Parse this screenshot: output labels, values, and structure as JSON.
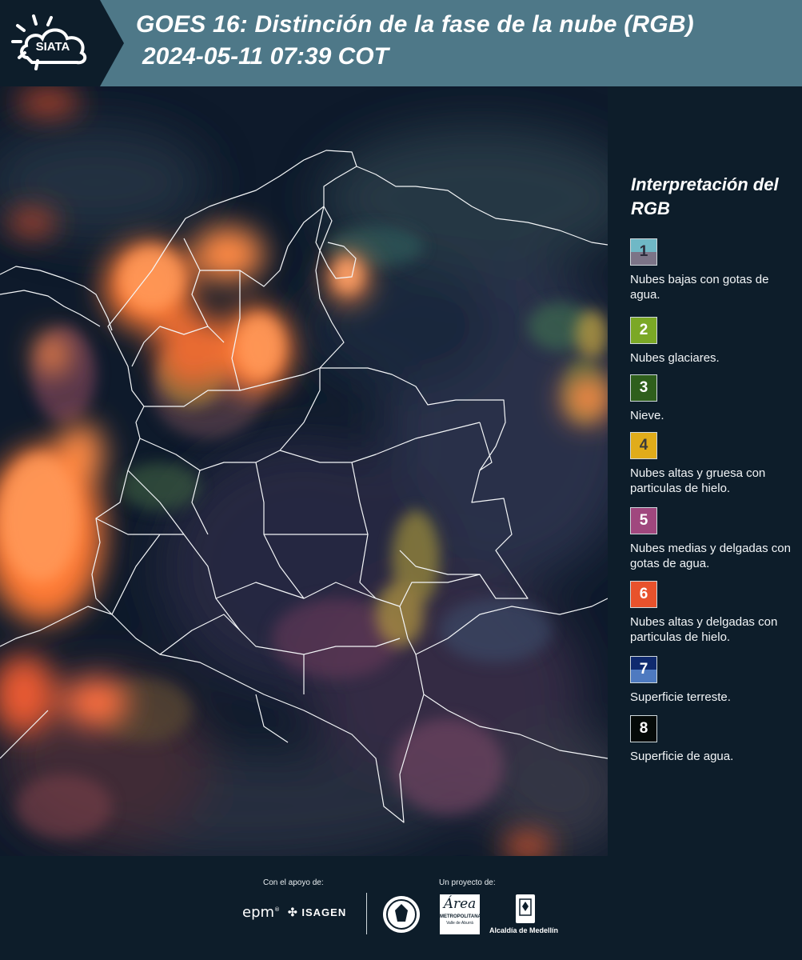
{
  "header": {
    "logo_text": "SIATA",
    "title_line1": "GOES 16: Distinción de la fase de la nube (RGB)",
    "title_line2": "2024-05-11 07:39 COT"
  },
  "legend": {
    "title": "Interpretación del RGB",
    "items": [
      {
        "number": "1",
        "label": "Nubes bajas con gotas de agua.",
        "color_top": "#6fb8c6",
        "color_bottom": "#7c7487"
      },
      {
        "number": "2",
        "label": "Nubes glaciares.",
        "color": "#7ba826"
      },
      {
        "number": "3",
        "label": "Nieve.",
        "color": "#2f5f1c"
      },
      {
        "number": "4",
        "label": "Nubes altas y gruesa con particulas de hielo.",
        "color": "#e0ac1a"
      },
      {
        "number": "5",
        "label": "Nubes medias y delgadas con gotas de agua.",
        "color": "#a0477e"
      },
      {
        "number": "6",
        "label": "Nubes altas y delgadas con particulas de hielo.",
        "color": "#e8522c"
      },
      {
        "number": "7",
        "label": "Superficie terreste.",
        "color_top": "#0f2a6e",
        "color_bottom": "#4e7ac0"
      },
      {
        "number": "8",
        "label": "Superficie de agua.",
        "color": "#050a08"
      }
    ]
  },
  "footer": {
    "support_label": "Con el apoyo de:",
    "project_label": "Un proyecto de:",
    "logos": {
      "epm": "epm",
      "isagen": "ISAGEN",
      "area_name": "Área",
      "area_sub": "METROPOLITANA",
      "area_sub2": "Valle de Aburrá",
      "alcaldia": "Alcaldía de Medellín"
    }
  },
  "colors": {
    "header_bg": "#4e7888",
    "logo_bg": "#0d1d2a",
    "panel_bg": "#0d1d2a",
    "map_bg": "#0b1624",
    "cloud_orange": "#ff7a35"
  }
}
